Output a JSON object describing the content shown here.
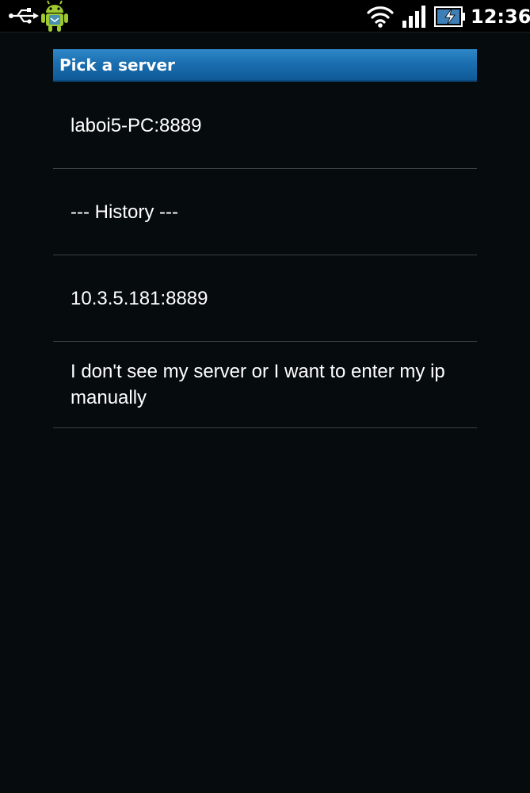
{
  "status_bar": {
    "time": "12:36",
    "icons": [
      "usb-icon",
      "android-debug-icon",
      "wifi-icon",
      "signal-icon",
      "battery-icon"
    ]
  },
  "dialog": {
    "title": "Pick a server",
    "items": [
      {
        "label": "laboi5-PC:8889"
      },
      {
        "label": "--- History ---"
      },
      {
        "label": "10.3.5.181:8889"
      },
      {
        "label": "I don't see my server or I want to enter my ip manually"
      }
    ]
  },
  "colors": {
    "title_bar": "#1b6fb1",
    "background": "#060b0d",
    "divider": "#3b4144"
  }
}
